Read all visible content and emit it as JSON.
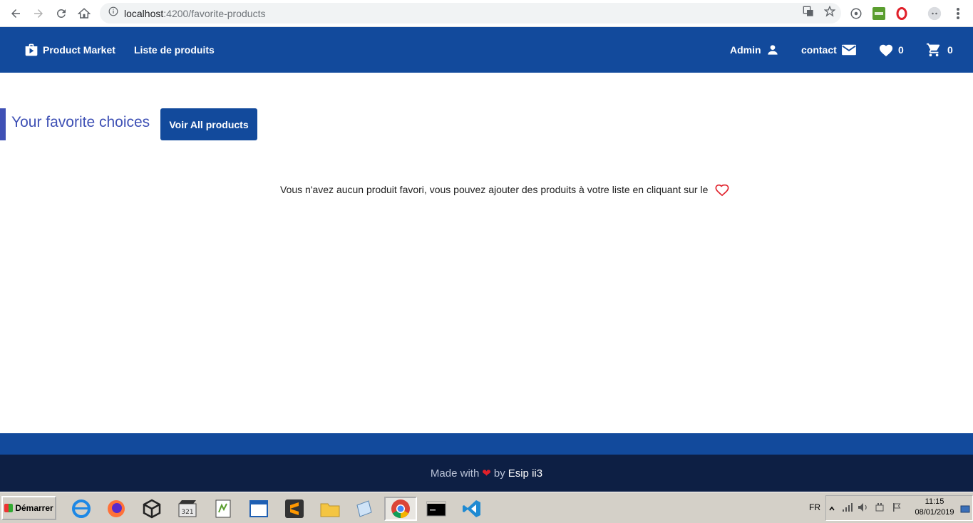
{
  "browser": {
    "url_host": "localhost",
    "url_path": ":4200/favorite-products"
  },
  "navbar": {
    "brand_label": "Product Market",
    "products_link": "Liste de produits",
    "admin_label": "Admin",
    "contact_label": "contact",
    "favorites_count": "0",
    "cart_count": "0"
  },
  "main": {
    "title": "Your favorite choices",
    "voir_button": "Voir All products",
    "empty_message": "Vous n'avez aucun produit favori, vous pouvez ajouter des produits à votre liste en cliquant sur le"
  },
  "footer": {
    "made_with": "Made with",
    "heart": "❤",
    "by": "by",
    "author": "Esip ii3"
  },
  "taskbar": {
    "start_label": "Démarrer",
    "language": "FR",
    "time": "11:15",
    "date": "08/01/2019"
  },
  "colors": {
    "navbar": "#124a9c",
    "title": "#3f51b5",
    "footer_dark": "#0d1f44",
    "heart": "#e0202a"
  }
}
